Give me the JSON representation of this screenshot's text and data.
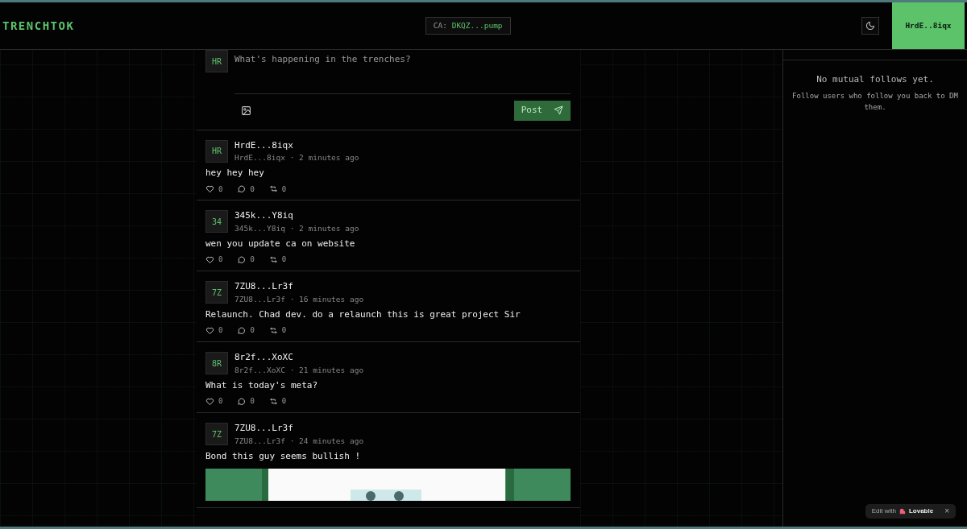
{
  "header": {
    "logo": "TRENCHTOK",
    "ca_label": "CA:",
    "ca_value": "DKQZ...pump",
    "wallet": "HrdE..8iqx"
  },
  "composer": {
    "avatar": "HR",
    "placeholder": "What's happening in the trenches?",
    "post_button": "Post"
  },
  "posts": [
    {
      "avatar": "HR",
      "name": "HrdE...8iqx",
      "meta": "HrdE...8iqx · 2 minutes ago",
      "text": "hey hey hey",
      "likes": "0",
      "comments": "0",
      "reposts": "0"
    },
    {
      "avatar": "34",
      "name": "345k...Y8iq",
      "meta": "345k...Y8iq · 2 minutes ago",
      "text": "wen you update ca on website",
      "likes": "0",
      "comments": "0",
      "reposts": "0"
    },
    {
      "avatar": "7Z",
      "name": "7ZU8...Lr3f",
      "meta": "7ZU8...Lr3f · 16 minutes ago",
      "text": "Relaunch. Chad dev. do a relaunch this is great project Sir",
      "likes": "0",
      "comments": "0",
      "reposts": "0"
    },
    {
      "avatar": "8R",
      "name": "8r2f...XoXC",
      "meta": "8r2f...XoXC · 21 minutes ago",
      "text": "What is today's meta?",
      "likes": "0",
      "comments": "0",
      "reposts": "0"
    },
    {
      "avatar": "7Z",
      "name": "7ZU8...Lr3f",
      "meta": "7ZU8...Lr3f · 24 minutes ago",
      "text": "Bond this guy seems bullish !"
    }
  ],
  "sidebar": {
    "empty_title": "No mutual follows yet.",
    "empty_hint": "Follow users who follow you back to DM them."
  },
  "badge": {
    "prefix": "Edit with",
    "brand": "Lovable",
    "close": "×"
  }
}
